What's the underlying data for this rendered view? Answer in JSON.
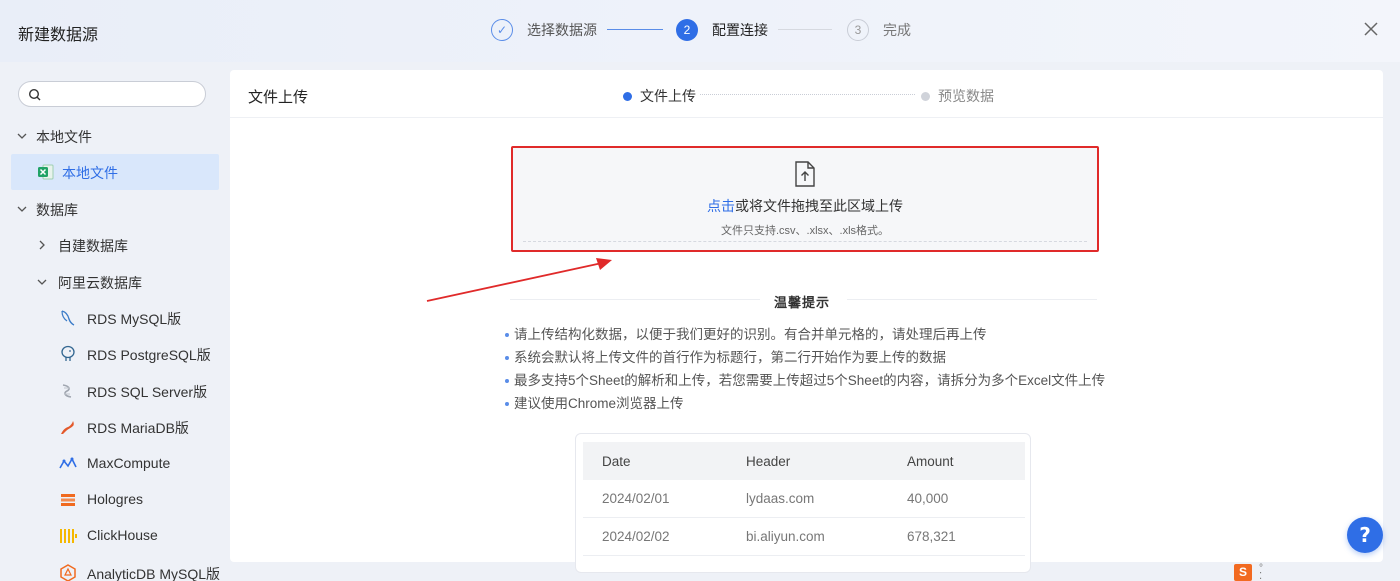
{
  "dialog": {
    "title": "新建数据源",
    "close_label": "×"
  },
  "steps": [
    {
      "number": "✓",
      "label": "选择数据源",
      "state": "done"
    },
    {
      "number": "2",
      "label": "配置连接",
      "state": "active"
    },
    {
      "number": "3",
      "label": "完成",
      "state": "todo"
    }
  ],
  "sidebar": {
    "search": {
      "placeholder": ""
    },
    "groups": [
      {
        "label": "本地文件",
        "expanded": true
      },
      {
        "label": "数据库",
        "expanded": true
      }
    ],
    "local_file_item": {
      "label": "本地文件",
      "icon": "excel-icon",
      "selected": true
    },
    "db_subgroups": [
      {
        "label": "自建数据库",
        "expanded": false
      },
      {
        "label": "阿里云数据库",
        "expanded": true
      }
    ],
    "db_items": [
      {
        "label": "RDS MySQL版",
        "icon": "mysql-dolphin-icon"
      },
      {
        "label": "RDS PostgreSQL版",
        "icon": "postgresql-elephant-icon"
      },
      {
        "label": "RDS SQL Server版",
        "icon": "sqlserver-icon"
      },
      {
        "label": "RDS MariaDB版",
        "icon": "mariadb-seal-icon"
      },
      {
        "label": "MaxCompute",
        "icon": "maxcompute-icon"
      },
      {
        "label": "Hologres",
        "icon": "hologres-icon"
      },
      {
        "label": "ClickHouse",
        "icon": "clickhouse-icon"
      },
      {
        "label": "AnalyticDB MySQL版",
        "icon": "analyticdb-icon"
      }
    ]
  },
  "main": {
    "title": "文件上传",
    "substeps": [
      {
        "label": "文件上传",
        "state": "active"
      },
      {
        "label": "预览数据",
        "state": "todo"
      }
    ],
    "upload": {
      "link_text": "点击",
      "text": "或将文件拖拽至此区域上传",
      "hint": "文件只支持.csv、.xlsx、.xls格式。"
    },
    "tips": {
      "title": "温馨提示",
      "items": [
        "请上传结构化数据，以便于我们更好的识别。有合并单元格的，请处理后再上传",
        "系统会默认将上传文件的首行作为标题行，第二行开始作为要上传的数据",
        "最多支持5个Sheet的解析和上传，若您需要上传超过5个Sheet的内容，请拆分为多个Excel文件上传",
        "建议使用Chrome浏览器上传"
      ]
    },
    "sample_table": {
      "columns": [
        "Date",
        "Header",
        "Amount"
      ],
      "rows": [
        [
          "2024/02/01",
          "lydaas.com",
          "40,000"
        ],
        [
          "2024/02/02",
          "bi.aliyun.com",
          "678,321"
        ]
      ]
    }
  },
  "help_button": {
    "label": "?"
  },
  "tray": {
    "sogou_label": "S"
  },
  "colors": {
    "accent": "#2f6ee6",
    "highlight_border": "#e02a2a",
    "selected_bg": "#d9e7fb"
  }
}
